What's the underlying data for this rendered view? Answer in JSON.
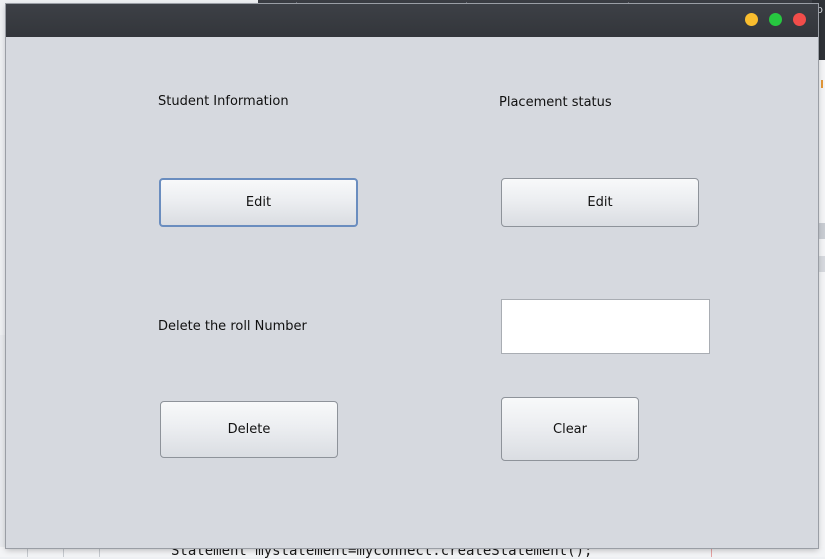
{
  "window": {
    "controls": {
      "minimize_color": "#f9bd2e",
      "maximize_color": "#27c840",
      "close_color": "#f24d4a"
    }
  },
  "student_info": {
    "title": "Student Information",
    "edit_button_label": "Edit"
  },
  "placement": {
    "title": "Placement status",
    "edit_button_label": "Edit"
  },
  "delete_section": {
    "label": "Delete the roll Number",
    "roll_number_value": "",
    "delete_button_label": "Delete",
    "clear_button_label": "Clear"
  },
  "background_code": {
    "line": "Statement mystatement=myconnect.createStatement();"
  },
  "background_right_glyph": "lb"
}
